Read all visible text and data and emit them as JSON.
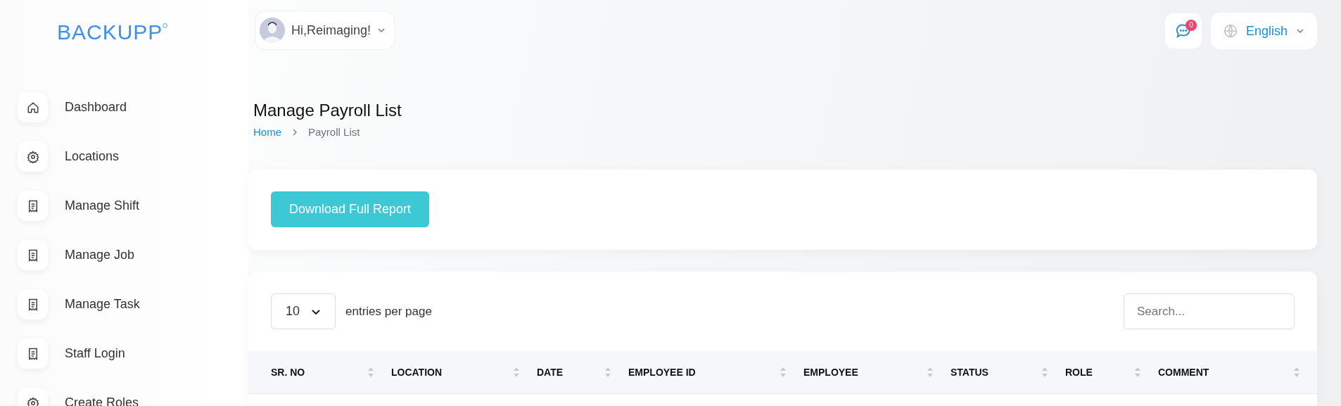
{
  "logo": "BACKUPP",
  "user_menu": {
    "greeting": "Hi,Reimaging!"
  },
  "messages": {
    "badge": "0"
  },
  "language": {
    "label": "English"
  },
  "sidebar": {
    "items": [
      {
        "label": "Dashboard",
        "kind": "home"
      },
      {
        "label": "Locations",
        "kind": "gear"
      },
      {
        "label": "Manage Shift",
        "kind": "receipt"
      },
      {
        "label": "Manage Job",
        "kind": "receipt"
      },
      {
        "label": "Manage Task",
        "kind": "receipt"
      },
      {
        "label": "Staff Login",
        "kind": "receipt"
      },
      {
        "label": "Create Roles",
        "kind": "gear"
      }
    ]
  },
  "page": {
    "title": "Manage Payroll List",
    "breadcrumb": [
      "Home",
      "Payroll List"
    ]
  },
  "actions": {
    "button": "Download Full Report"
  },
  "table": {
    "page_size": "10",
    "page_size_label": "entries per page",
    "search": {
      "placeholder": "Search..."
    },
    "columns": [
      "SR. NO",
      "LOCATION",
      "DATE",
      "EMPLOYEE ID",
      "EMPLOYEE",
      "STATUS",
      "ROLE",
      "COMMENT"
    ]
  }
}
